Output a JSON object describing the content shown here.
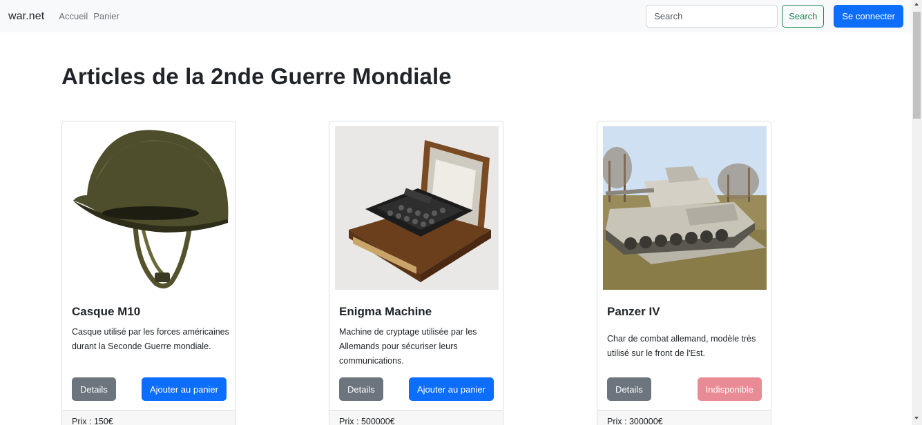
{
  "navbar": {
    "brand": "war.net",
    "links": [
      "Accueil",
      "Panier"
    ],
    "search_placeholder": "Search",
    "search_button": "Search",
    "login_button": "Se connecter"
  },
  "page": {
    "title": "Articles de la 2nde Guerre Mondiale"
  },
  "products": [
    {
      "title": "Casque M10",
      "description": "Casque utilisé par les forces américaines durant la Seconde Guerre mondiale.",
      "details_button": "Details",
      "action_button": "Ajouter au panier",
      "price": "Prix : 150€"
    },
    {
      "title": "Enigma Machine",
      "description": "Machine de cryptage utilisée par les Allemands pour sécuriser leurs communications.",
      "details_button": "Details",
      "action_button": "Ajouter au panier",
      "price": "Prix : 500000€"
    },
    {
      "title": "Panzer IV",
      "description": "Char de combat allemand, modèle très utilisé sur le front de l'Est.",
      "details_button": "Details",
      "action_button": "Indisponible",
      "price": "Prix : 300000€"
    }
  ],
  "colors": {
    "primary": "#0d6efd",
    "success": "#198754",
    "secondary": "#6c757d",
    "danger_disabled": "#e98b94",
    "navbar_bg": "#f8f9fa"
  }
}
